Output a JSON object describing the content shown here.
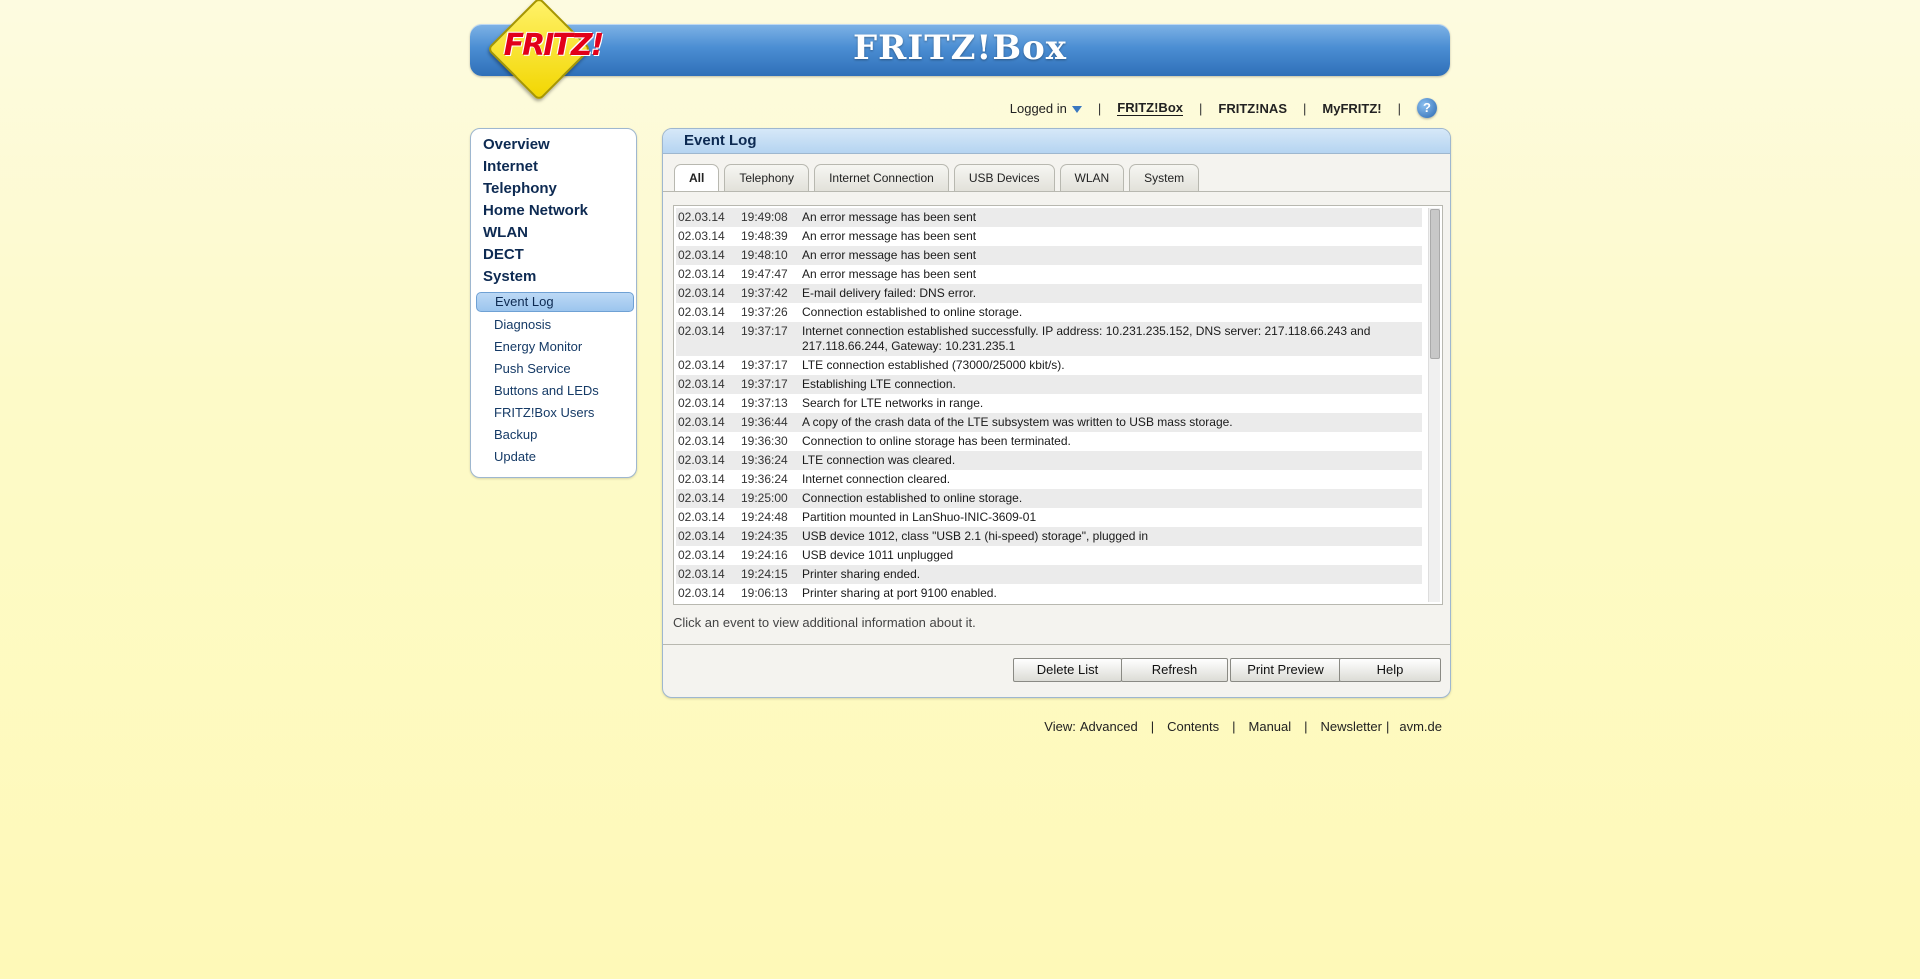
{
  "header": {
    "logo_text": "FRITZ!",
    "brand": "FRITZ!Box"
  },
  "topnav": {
    "logged_in": "Logged in",
    "links": [
      "FRITZ!Box",
      "FRITZ!NAS",
      "MyFRITZ!"
    ],
    "help": "?"
  },
  "sidebar": {
    "main": [
      "Overview",
      "Internet",
      "Telephony",
      "Home Network",
      "WLAN",
      "DECT",
      "System"
    ],
    "sub": [
      "Event Log",
      "Diagnosis",
      "Energy Monitor",
      "Push Service",
      "Buttons and LEDs",
      "FRITZ!Box Users",
      "Backup",
      "Update"
    ],
    "active_sub": "Event Log"
  },
  "panel": {
    "title": "Event Log",
    "tabs": [
      "All",
      "Telephony",
      "Internet Connection",
      "USB Devices",
      "WLAN",
      "System"
    ],
    "active_tab": "All",
    "hint": "Click an event to view additional information about it.",
    "buttons": [
      "Delete List",
      "Refresh",
      "Print Preview",
      "Help"
    ]
  },
  "log": [
    {
      "date": "02.03.14",
      "time": "19:49:08",
      "msg": "An error message has been sent"
    },
    {
      "date": "02.03.14",
      "time": "19:48:39",
      "msg": "An error message has been sent"
    },
    {
      "date": "02.03.14",
      "time": "19:48:10",
      "msg": "An error message has been sent"
    },
    {
      "date": "02.03.14",
      "time": "19:47:47",
      "msg": "An error message has been sent"
    },
    {
      "date": "02.03.14",
      "time": "19:37:42",
      "msg": "E-mail delivery failed: DNS error."
    },
    {
      "date": "02.03.14",
      "time": "19:37:26",
      "msg": "Connection established to online storage."
    },
    {
      "date": "02.03.14",
      "time": "19:37:17",
      "msg": "Internet connection established successfully. IP address: 10.231.235.152, DNS server: 217.118.66.243 and 217.118.66.244, Gateway: 10.231.235.1"
    },
    {
      "date": "02.03.14",
      "time": "19:37:17",
      "msg": "LTE connection established (73000/25000 kbit/s)."
    },
    {
      "date": "02.03.14",
      "time": "19:37:17",
      "msg": "Establishing LTE connection."
    },
    {
      "date": "02.03.14",
      "time": "19:37:13",
      "msg": "Search for LTE networks in range."
    },
    {
      "date": "02.03.14",
      "time": "19:36:44",
      "msg": "A copy of the crash data of the LTE subsystem was written to USB mass storage."
    },
    {
      "date": "02.03.14",
      "time": "19:36:30",
      "msg": "Connection to online storage has been terminated."
    },
    {
      "date": "02.03.14",
      "time": "19:36:24",
      "msg": "LTE connection was cleared."
    },
    {
      "date": "02.03.14",
      "time": "19:36:24",
      "msg": "Internet connection cleared."
    },
    {
      "date": "02.03.14",
      "time": "19:25:00",
      "msg": "Connection established to online storage."
    },
    {
      "date": "02.03.14",
      "time": "19:24:48",
      "msg": "Partition mounted in LanShuo-INIC-3609-01"
    },
    {
      "date": "02.03.14",
      "time": "19:24:35",
      "msg": "USB device 1012, class \"USB 2.1 (hi-speed) storage\", plugged in"
    },
    {
      "date": "02.03.14",
      "time": "19:24:16",
      "msg": "USB device 1011 unplugged"
    },
    {
      "date": "02.03.14",
      "time": "19:24:15",
      "msg": "Printer sharing ended."
    },
    {
      "date": "02.03.14",
      "time": "19:06:13",
      "msg": "Printer sharing at port 9100 enabled."
    }
  ],
  "footer": {
    "view_label": "View:",
    "view_value": "Advanced",
    "links": [
      "Contents",
      "Manual",
      "Newsletter"
    ],
    "site": "avm.de"
  },
  "colors": {
    "accent": "#3a77c0",
    "brand_red": "#e2001a",
    "logo_yellow": "#f2d600"
  }
}
